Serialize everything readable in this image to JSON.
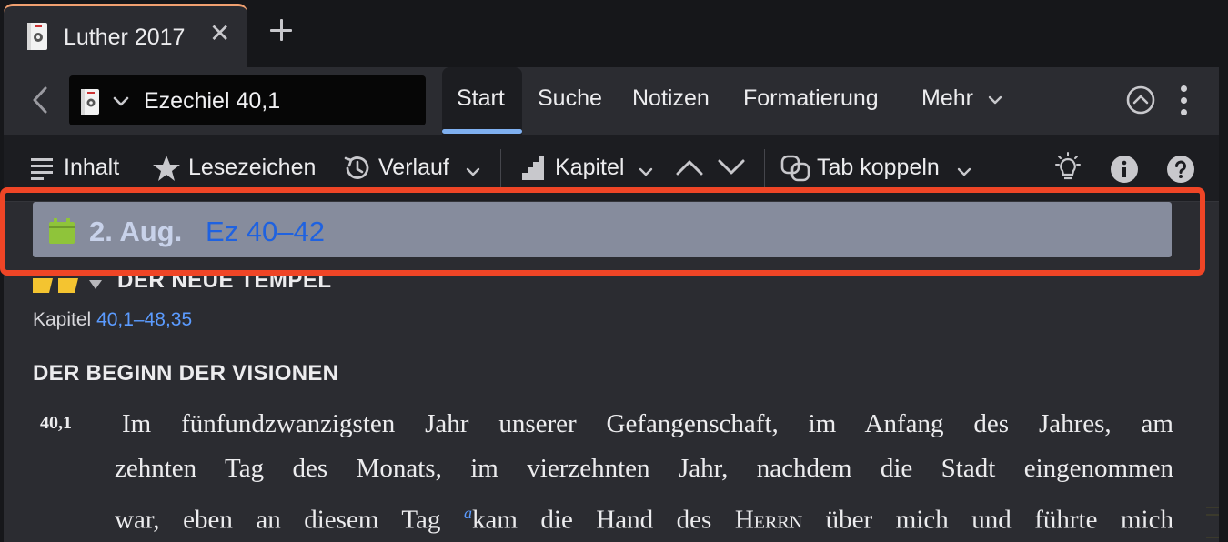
{
  "tabstrip": {
    "active_tab": {
      "title": "Luther 2017",
      "close": "✕"
    },
    "new_tab": "+"
  },
  "nav": {
    "reference": "Ezechiel 40,1",
    "tabs": [
      "Start",
      "Suche",
      "Notizen",
      "Formatierung",
      "Mehr"
    ],
    "active_tab": "Start"
  },
  "toolbar": {
    "inhalt": "Inhalt",
    "lesezeichen": "Lesezeichen",
    "verlauf": "Verlauf",
    "kapitel": "Kapitel",
    "tab_koppeln": "Tab koppeln"
  },
  "reading_plan": {
    "date": "2. Aug.",
    "link": "Ez 40–42"
  },
  "content": {
    "section_title": "DER NEUE TEMPEL",
    "kapitel_label": "Kapitel",
    "kapitel_range": "40,1–48,35",
    "pericope_title": "DER BEGINN DER VISIONEN",
    "verse_number": "40,1",
    "line1": "Im fünfundzwanzigsten Jahr unserer Gefangenschaft, im Anfang des Jahres, am",
    "line2": "zehnten Tag des Monats, im vierzehnten Jahr, nachdem die Stadt eingenommen",
    "line3_a": "war, eben an diesem Tag ",
    "footnote": "a",
    "line3_b": "kam die Hand des ",
    "herrn": "Herrn",
    "line3_c": " über mich und führte mich"
  },
  "colors": {
    "background": "#2b2c31",
    "toolbar": "#1c1d21",
    "accent_link": "#5b9bff",
    "reading_plan_bg": "#868c9d",
    "highlight_frame": "#ef4526",
    "calendar_icon": "#8fc43a"
  },
  "icons": [
    "book-icon",
    "close-icon",
    "plus-icon",
    "back-icon",
    "chevron-down-icon",
    "collapse-icon",
    "more-icon",
    "list-icon",
    "star-icon",
    "history-icon",
    "chapter-icon",
    "chevron-up-icon",
    "link-icon",
    "lightbulb-icon",
    "info-icon",
    "help-icon",
    "calendar-icon"
  ]
}
